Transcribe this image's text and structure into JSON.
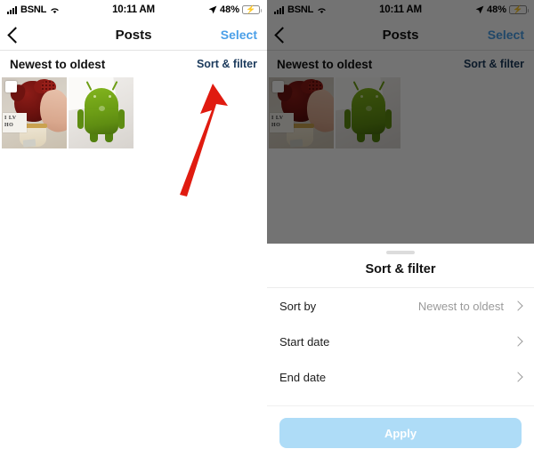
{
  "screens": [
    {
      "id": "before",
      "status_bar": {
        "carrier": "BSNL",
        "time": "10:11 AM",
        "battery_percent": "48%",
        "signal_icon": "signal-bars-icon",
        "wifi_icon": "wifi-icon",
        "location_icon": "location-arrow-icon",
        "battery_icon": "battery-charging-icon"
      },
      "nav": {
        "back_icon": "back-chevron-icon",
        "title": "Posts",
        "action_label": "Select"
      },
      "sort_row": {
        "current_sort": "Newest to oldest",
        "link_label": "Sort & filter"
      },
      "photos": [
        {
          "alt": "flower-bouquet-photo",
          "selected": false
        },
        {
          "alt": "android-robot-photo",
          "selected": false
        }
      ],
      "annotation": {
        "type": "arrow",
        "color": "#E01B10",
        "points_to": "Sort & filter"
      }
    },
    {
      "id": "after",
      "status_bar": {
        "carrier": "BSNL",
        "time": "10:11 AM",
        "battery_percent": "48%",
        "signal_icon": "signal-bars-icon",
        "wifi_icon": "wifi-icon",
        "location_icon": "location-arrow-icon",
        "battery_icon": "battery-charging-icon"
      },
      "nav": {
        "back_icon": "back-chevron-icon",
        "title": "Posts",
        "action_label": "Select"
      },
      "sort_row": {
        "current_sort": "Newest to oldest",
        "link_label": "Sort & filter"
      },
      "photos": [
        {
          "alt": "flower-bouquet-photo",
          "selected": false
        },
        {
          "alt": "android-robot-photo",
          "selected": false
        }
      ],
      "sheet": {
        "title": "Sort & filter",
        "grabber": "drag-handle",
        "rows": [
          {
            "label": "Sort by",
            "value": "Newest to oldest",
            "chevron": "chevron-right-icon"
          },
          {
            "label": "Start date",
            "value": "",
            "chevron": "chevron-right-icon"
          },
          {
            "label": "End date",
            "value": "",
            "chevron": "chevron-right-icon"
          }
        ],
        "apply_label": "Apply",
        "apply_color": "#AEDCF7"
      }
    }
  ],
  "colors": {
    "select_link": "#4A9FE8",
    "sort_link": "#1B3A5C",
    "battery_green": "#34C759",
    "annotation_red": "#E01B10",
    "apply_bg": "#AEDCF7"
  }
}
